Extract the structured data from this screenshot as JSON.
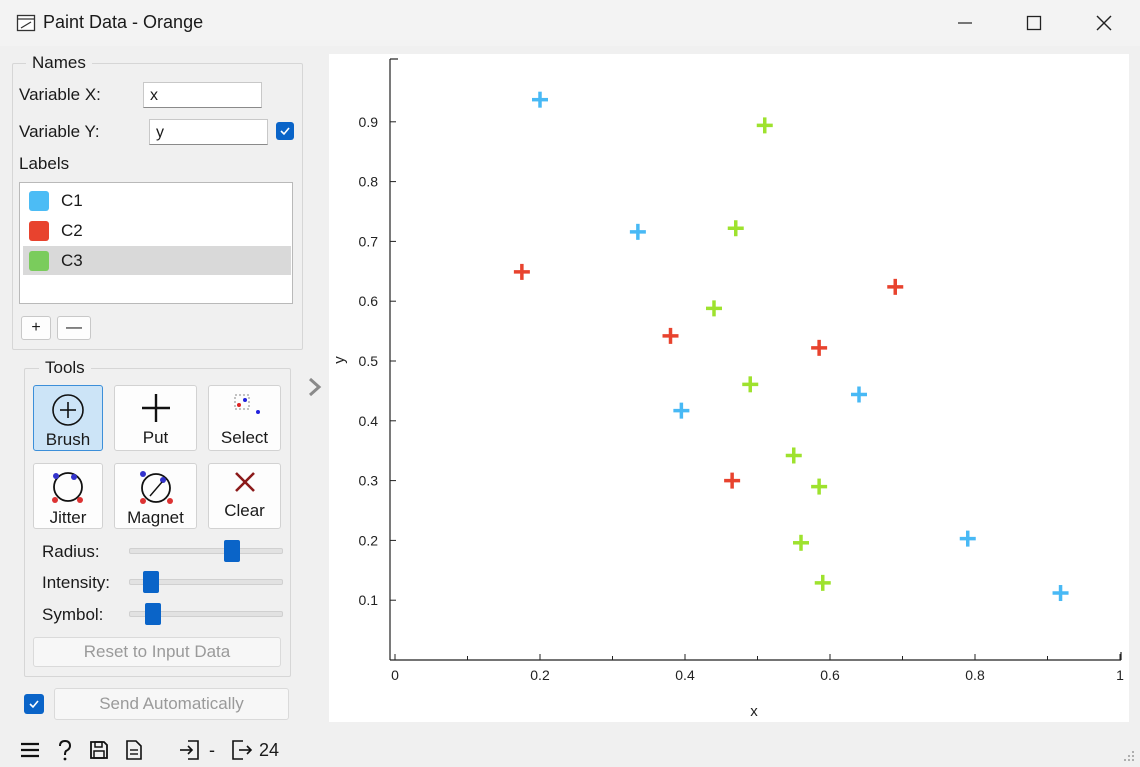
{
  "window": {
    "title": "Paint Data - Orange"
  },
  "names": {
    "group_title": "Names",
    "variable_x_label": "Variable X:",
    "variable_x_value": "x",
    "variable_y_label": "Variable Y:",
    "variable_y_value": "y",
    "variable_y_checked": true,
    "labels_title": "Labels",
    "labels": [
      {
        "name": "C1",
        "color": "#4cbcf5"
      },
      {
        "name": "C2",
        "color": "#e8432e"
      },
      {
        "name": "C3",
        "color": "#7acc5c"
      }
    ],
    "selected_label": "C3",
    "add_label": "+",
    "remove_label": "—"
  },
  "tools": {
    "group_title": "Tools",
    "items": [
      {
        "label": "Brush",
        "icon": "brush-icon",
        "active": true
      },
      {
        "label": "Put",
        "icon": "put-icon",
        "active": false
      },
      {
        "label": "Select",
        "icon": "select-icon",
        "active": false
      },
      {
        "label": "Jitter",
        "icon": "jitter-icon",
        "active": false
      },
      {
        "label": "Magnet",
        "icon": "magnet-icon",
        "active": false
      },
      {
        "label": "Clear",
        "icon": "clear-icon",
        "active": false
      }
    ],
    "radius_label": "Radius:",
    "intensity_label": "Intensity:",
    "symbol_label": "Symbol:",
    "radius_level": 0.7,
    "intensity_level": 0.1,
    "symbol_level": 0.12,
    "reset_label": "Reset to Input Data"
  },
  "send": {
    "checked": true,
    "label": "Send Automatically"
  },
  "statusbar": {
    "input_count": "-",
    "output_count": "24"
  },
  "chart_data": {
    "type": "scatter",
    "xlabel": "x",
    "ylabel": "y",
    "xlim": [
      0,
      1
    ],
    "ylim": [
      0,
      1
    ],
    "x_ticks": [
      "0",
      "0.2",
      "0.4",
      "0.6",
      "0.8",
      "1"
    ],
    "y_ticks": [
      "0.1",
      "0.2",
      "0.3",
      "0.4",
      "0.5",
      "0.6",
      "0.7",
      "0.8",
      "0.9"
    ],
    "marker": "plus",
    "series": [
      {
        "name": "C1",
        "color": "#48b9f5",
        "points": [
          [
            0.2,
            0.937
          ],
          [
            0.335,
            0.716
          ],
          [
            0.395,
            0.417
          ],
          [
            0.64,
            0.444
          ],
          [
            0.79,
            0.203
          ],
          [
            0.918,
            0.112
          ]
        ]
      },
      {
        "name": "C2",
        "color": "#e8432e",
        "points": [
          [
            0.175,
            0.649
          ],
          [
            0.38,
            0.542
          ],
          [
            0.465,
            0.3
          ],
          [
            0.585,
            0.522
          ],
          [
            0.69,
            0.624
          ]
        ]
      },
      {
        "name": "C3",
        "color": "#9ee22e",
        "points": [
          [
            0.51,
            0.894
          ],
          [
            0.47,
            0.722
          ],
          [
            0.44,
            0.588
          ],
          [
            0.49,
            0.461
          ],
          [
            0.55,
            0.342
          ],
          [
            0.585,
            0.29
          ],
          [
            0.56,
            0.196
          ],
          [
            0.59,
            0.129
          ]
        ]
      }
    ]
  }
}
